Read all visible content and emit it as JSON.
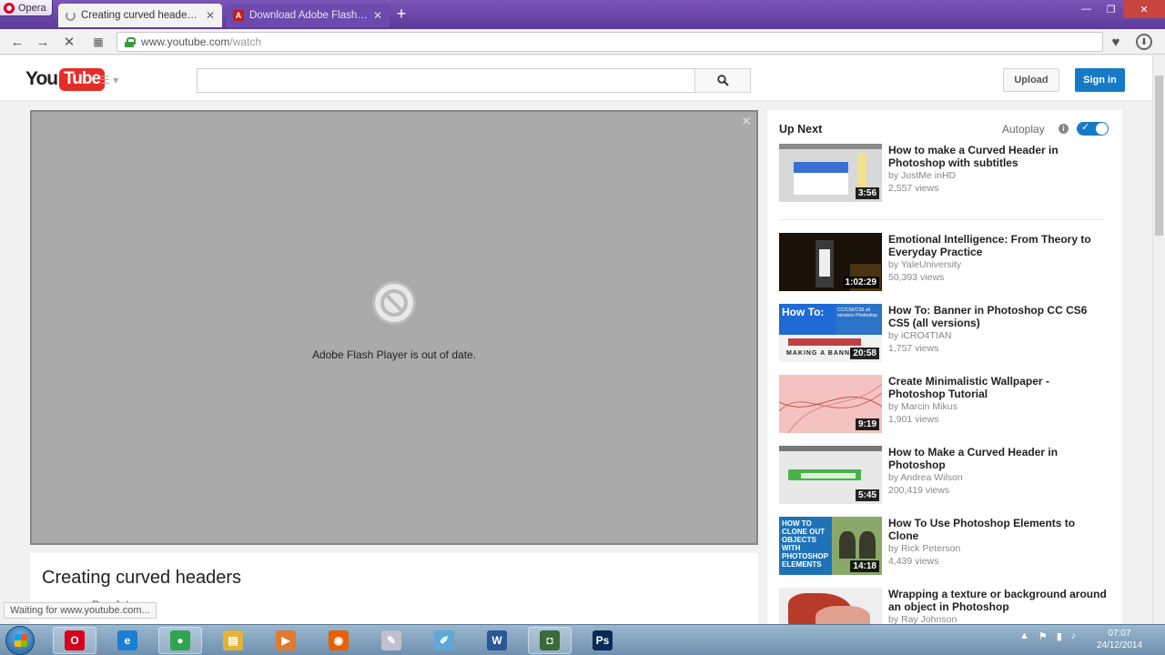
{
  "browser": {
    "menu_label": "Opera",
    "tabs": [
      {
        "title": "Creating curved headers - YouTube",
        "close": "✕"
      },
      {
        "title": "Download Adobe Flash Player",
        "close": "✕"
      }
    ],
    "new_tab": "+",
    "window_controls": {
      "minimize": "—",
      "maximize": "❐",
      "close": "✕"
    },
    "nav": {
      "back": "←",
      "forward": "→",
      "stop": "✕",
      "speed_dial": "▦"
    },
    "url_host": "www.youtube.com",
    "url_path": "/watch",
    "bookmark_icon": "♥",
    "downloads_icon": "⬇"
  },
  "youtube": {
    "logo_you": "You",
    "logo_tube": "Tube",
    "guide_icon": "☰ ▾",
    "search_placeholder": "",
    "upload_label": "Upload",
    "signin_label": "Sign in"
  },
  "player": {
    "close": "✕",
    "message": "Adobe Flash Player is out of date."
  },
  "video": {
    "title": "Creating curved headers",
    "uploader": "Ray Johnson",
    "status_text": "Waiting for www.youtube.com..."
  },
  "sidebar": {
    "up_next_label": "Up Next",
    "autoplay_label": "Autoplay",
    "info_icon": "i",
    "autoplay_on": true,
    "videos": [
      {
        "title": "How to make a Curved Header in Photoshop with subtitles",
        "channel": "by JustMe inHD",
        "views": "2,557 views",
        "duration": "3:56"
      },
      {
        "title": "Emotional Intelligence: From Theory to Everyday Practice",
        "channel": "by YaleUniversity",
        "views": "50,393 views",
        "duration": "1:02:29"
      },
      {
        "title": "How To: Banner in Photoshop CC CS6 CS5 (all versions)",
        "channel": "by iCRO4TIAN",
        "views": "1,757 views",
        "duration": "20:58",
        "thumb_text": "How To:",
        "thumb_sub": "CC/CS6/CS5 all versions Photoshop",
        "thumb_banner": "MAKING A BANNER"
      },
      {
        "title": "Create Minimalistic Wallpaper - Photoshop Tutorial",
        "channel": "by Marcin Mikus",
        "views": "1,901 views",
        "duration": "9:19"
      },
      {
        "title": "How to Make a Curved Header in Photoshop",
        "channel": "by Andrea Wilson",
        "views": "200,419 views",
        "duration": "5:45"
      },
      {
        "title": "How To Use Photoshop Elements to Clone",
        "channel": "by Rick Peterson",
        "views": "4,439 views",
        "duration": "14:18",
        "thumb_text": "HOW TO CLONE OUT OBJECTS WITH PHOTOSHOP ELEMENTS"
      },
      {
        "title": "Wrapping a texture or background around an object in Photoshop",
        "channel": "by Ray Johnson",
        "views": "",
        "duration": ""
      }
    ]
  },
  "taskbar": {
    "apps": [
      {
        "name": "opera",
        "glyph": "O",
        "color": "#d5001c",
        "active": true
      },
      {
        "name": "internet-explorer",
        "glyph": "e",
        "color": "#1b7fd1",
        "active": false
      },
      {
        "name": "chrome",
        "glyph": "●",
        "color": "#2ea44f",
        "active": true
      },
      {
        "name": "explorer",
        "glyph": "▤",
        "color": "#e2b33a",
        "active": false
      },
      {
        "name": "media-player",
        "glyph": "▶",
        "color": "#e07a2e",
        "active": false
      },
      {
        "name": "firefox",
        "glyph": "◉",
        "color": "#e66000",
        "active": false
      },
      {
        "name": "paint",
        "glyph": "✎",
        "color": "#c0c0d0",
        "active": false
      },
      {
        "name": "notepad",
        "glyph": "✐",
        "color": "#5fa8d8",
        "active": false
      },
      {
        "name": "word",
        "glyph": "W",
        "color": "#2b5797",
        "active": false
      },
      {
        "name": "camera",
        "glyph": "◘",
        "color": "#3a6a3a",
        "active": true
      },
      {
        "name": "photoshop",
        "glyph": "Ps",
        "color": "#0b2a55",
        "active": false
      }
    ],
    "tray": {
      "up": "▲",
      "flag": "⚑",
      "network": "▮",
      "volume": "♪"
    },
    "time": "07:07",
    "date": "24/12/2014"
  },
  "colors": {
    "opera_purple": "#6b48ab",
    "youtube_red": "#e52d27",
    "signin_blue": "#167ac6"
  }
}
